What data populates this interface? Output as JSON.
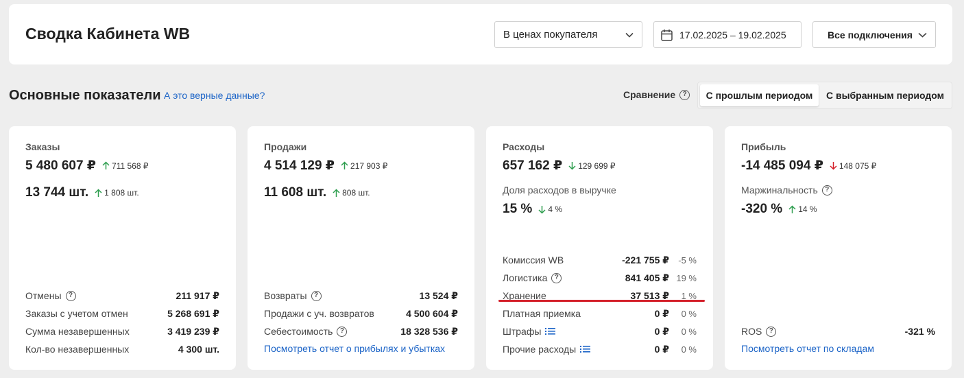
{
  "header": {
    "title": "Сводка Кабинета WB",
    "price_mode": "В ценах покупателя",
    "date_range": "17.02.2025 – 19.02.2025",
    "connections": "Все подключения"
  },
  "section": {
    "title": "Основные показатели",
    "link": "А это верные данные?",
    "compare_label": "Сравнение",
    "compare_options": [
      "С прошлым периодом",
      "С выбранным периодом"
    ],
    "compare_active": "С прошлым периодом"
  },
  "colors": {
    "up": "#2e9e4f",
    "down": "#d4202a",
    "link": "#1c64c7"
  },
  "cards": {
    "orders": {
      "title": "Заказы",
      "sum": "5 480 607 ₽",
      "sum_delta": "711 568 ₽",
      "sum_dir": "up",
      "qty": "13 744 шт.",
      "qty_delta": "1 808 шт.",
      "qty_dir": "up",
      "rows": [
        {
          "label": "Отмены",
          "value": "211 917 ₽",
          "help": true
        },
        {
          "label": "Заказы с учетом отмен",
          "value": "5 268 691 ₽"
        },
        {
          "label": "Сумма незавершенных",
          "value": "3 419 239 ₽"
        },
        {
          "label": "Кол-во незавершенных",
          "value": "4 300 шт."
        }
      ]
    },
    "sales": {
      "title": "Продажи",
      "sum": "4 514 129 ₽",
      "sum_delta": "217 903 ₽",
      "sum_dir": "up",
      "qty": "11 608 шт.",
      "qty_delta": "808 шт.",
      "qty_dir": "up",
      "rows": [
        {
          "label": "Возвраты",
          "value": "13 524 ₽",
          "help": true
        },
        {
          "label": "Продажи с уч. возвратов",
          "value": "4 500 604 ₽"
        },
        {
          "label": "Себестоимость",
          "value": "18 328 536 ₽",
          "help": true
        }
      ],
      "link": "Посмотреть отчет о прибылях и убытках"
    },
    "expenses": {
      "title": "Расходы",
      "sum": "657 162 ₽",
      "sum_delta": "129 699 ₽",
      "sum_dir": "down-good",
      "share_label": "Доля расходов в выручке",
      "share": "15 %",
      "share_delta": "4 %",
      "share_dir": "down-good",
      "rows": [
        {
          "label": "Комиссия WB",
          "value": "-221 755 ₽",
          "pct": "-5 %"
        },
        {
          "label": "Логистика",
          "value": "841 405 ₽",
          "pct": "19 %",
          "help": true
        },
        {
          "label": "Хранение",
          "value": "37 513 ₽",
          "pct": "1 %"
        },
        {
          "label": "Платная приемка",
          "value": "0 ₽",
          "pct": "0 %"
        },
        {
          "label": "Штрафы",
          "value": "0 ₽",
          "pct": "0 %",
          "list": true
        },
        {
          "label": "Прочие расходы",
          "value": "0 ₽",
          "pct": "0 %",
          "list": true
        }
      ]
    },
    "profit": {
      "title": "Прибыль",
      "sum": "-14 485 094 ₽",
      "sum_delta": "148 075 ₽",
      "sum_dir": "down-bad",
      "margin_label": "Маржинальность",
      "margin": "-320 %",
      "margin_delta": "14 %",
      "margin_dir": "up",
      "ros_label": "ROS",
      "ros_value": "-321 %",
      "link": "Посмотреть отчет по складам"
    }
  }
}
